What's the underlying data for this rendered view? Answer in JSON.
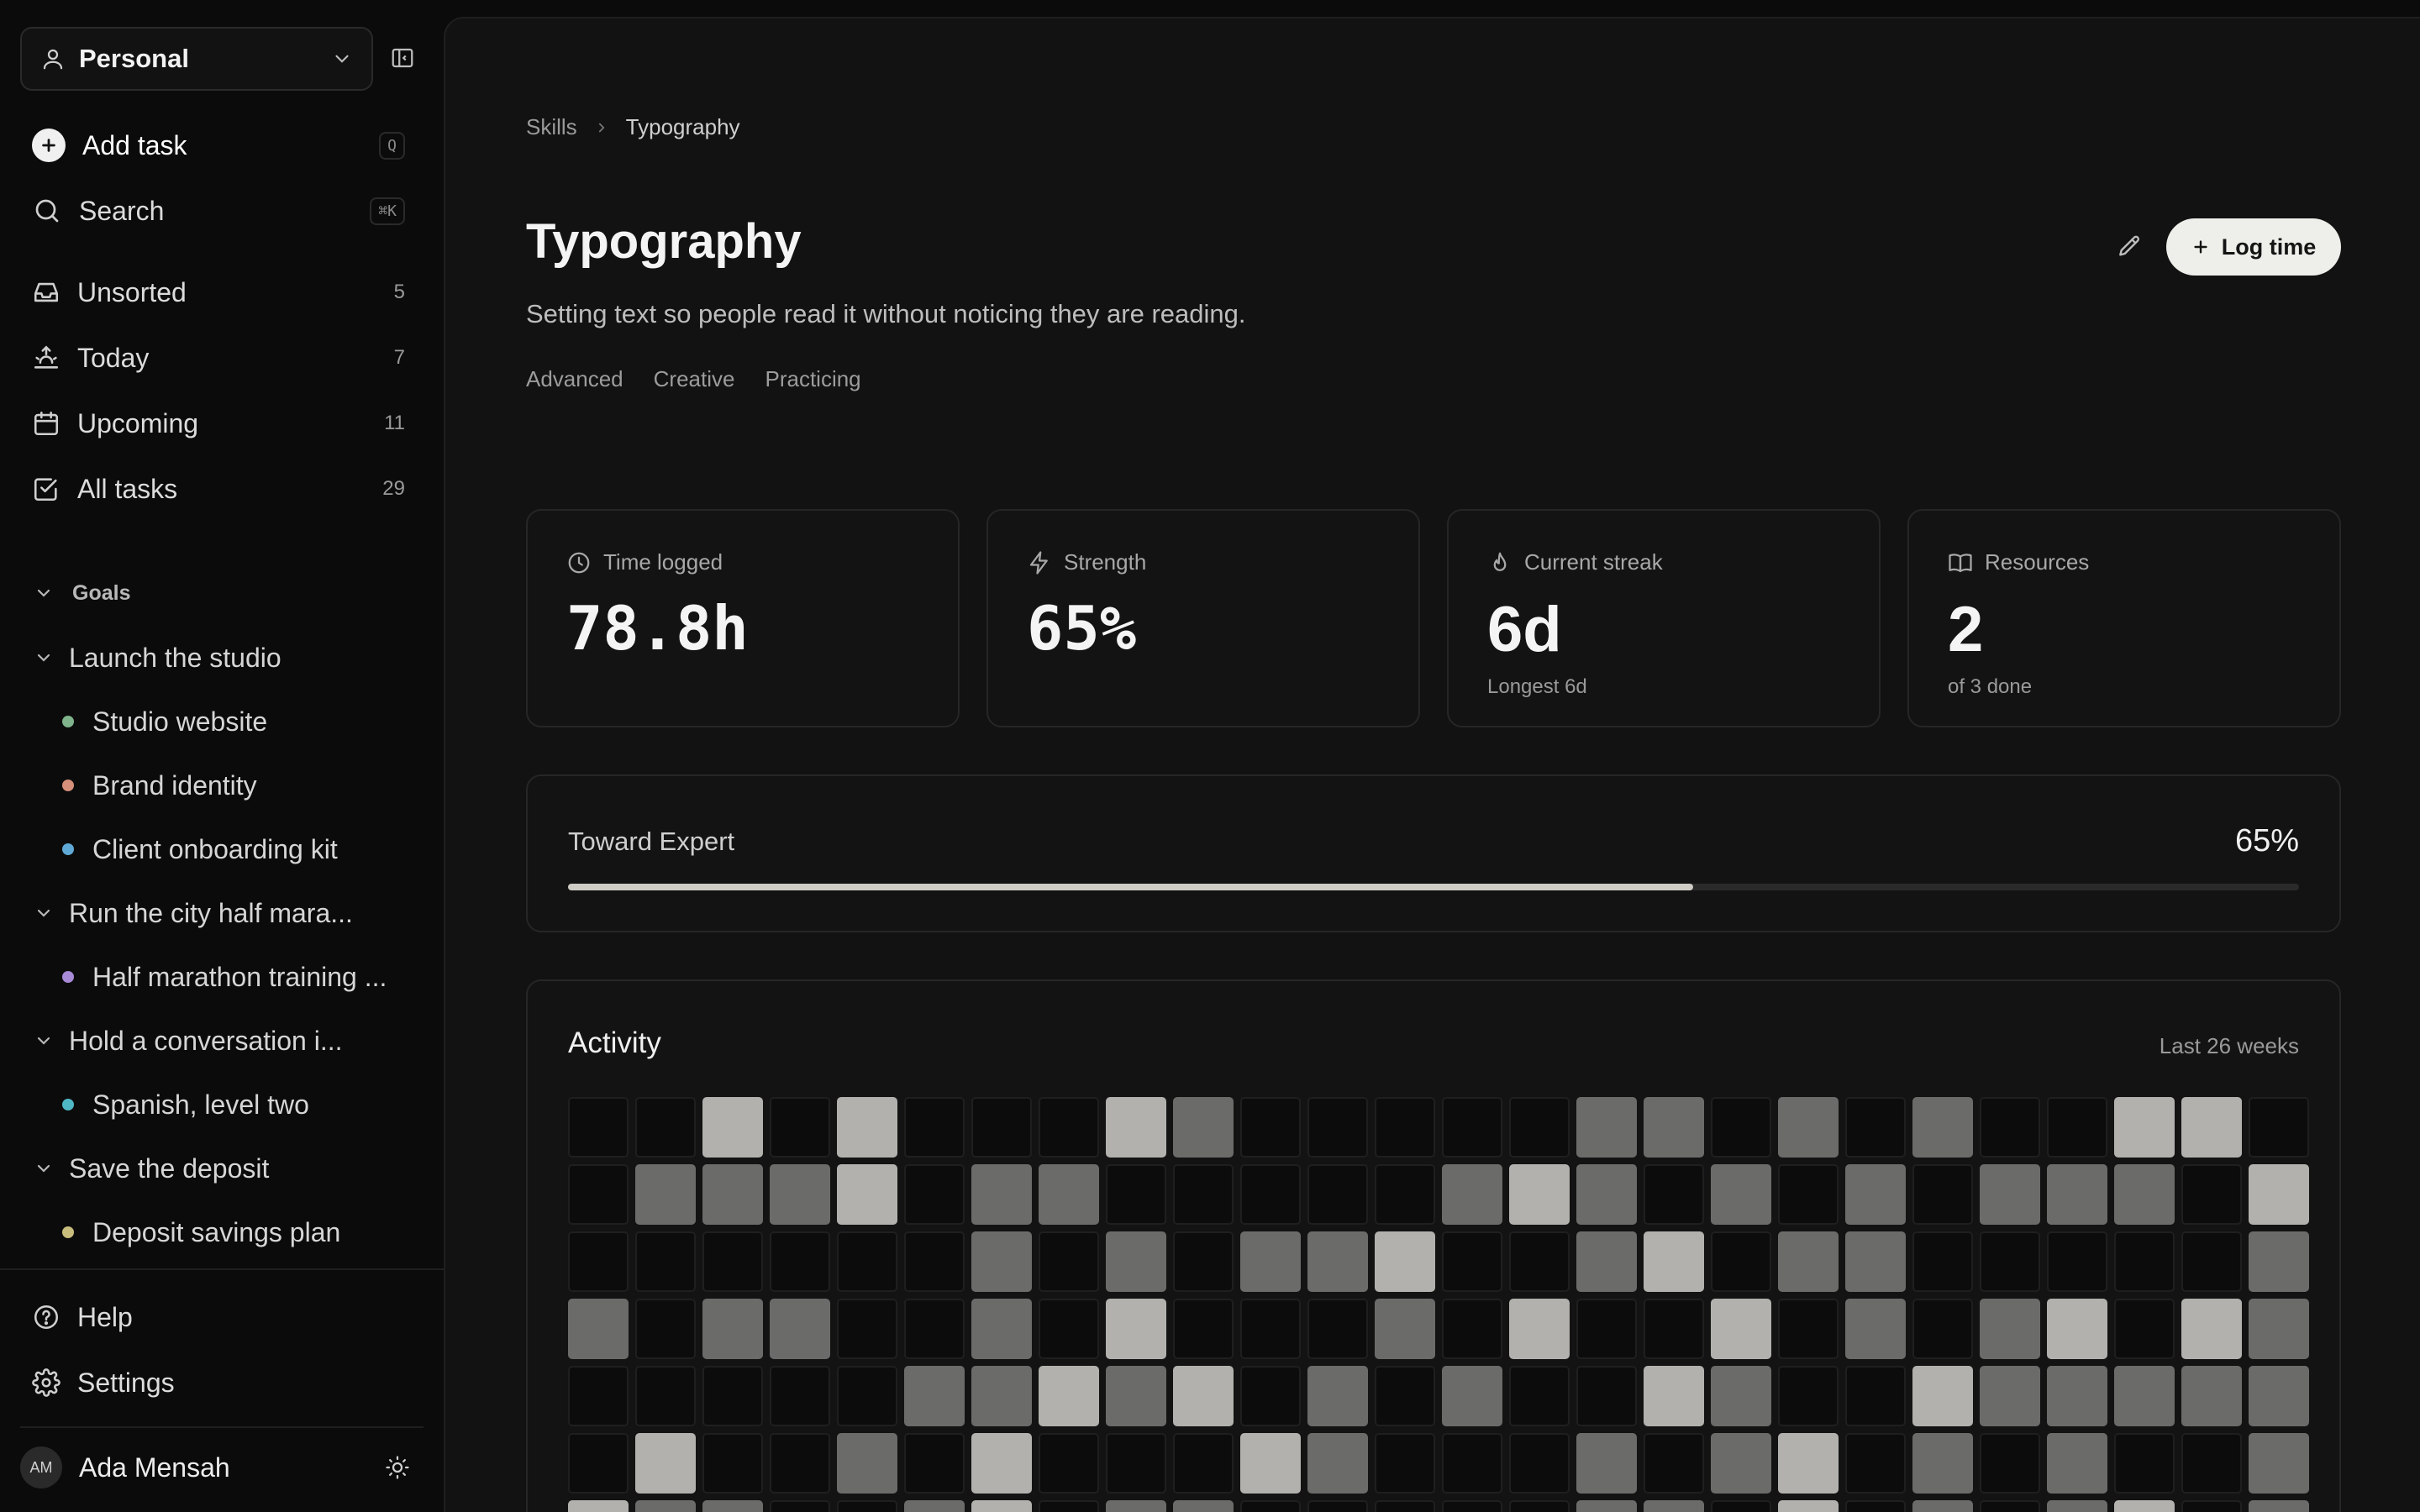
{
  "sidebar": {
    "workspace": "Personal",
    "add_task": {
      "label": "Add task",
      "shortcut": "Q"
    },
    "search": {
      "label": "Search",
      "shortcut": "⌘K"
    },
    "nav": [
      {
        "label": "Unsorted",
        "count": "5",
        "icon": "inbox-icon"
      },
      {
        "label": "Today",
        "count": "7",
        "icon": "sunrise-icon"
      },
      {
        "label": "Upcoming",
        "count": "11",
        "icon": "calendar-icon"
      },
      {
        "label": "All tasks",
        "count": "29",
        "icon": "check-square-icon"
      }
    ],
    "goals_header": "Goals",
    "goals": [
      {
        "label": "Launch the studio",
        "projects": [
          {
            "label": "Studio website",
            "color": "#7fb38b"
          },
          {
            "label": "Brand identity",
            "color": "#d68f7a"
          },
          {
            "label": "Client onboarding kit",
            "color": "#5fa9d6"
          }
        ]
      },
      {
        "label": "Run the city half mara...",
        "projects": [
          {
            "label": "Half marathon training ...",
            "color": "#a98ad6"
          }
        ]
      },
      {
        "label": "Hold a conversation i...",
        "projects": [
          {
            "label": "Spanish, level two",
            "color": "#4fb6c4"
          }
        ]
      },
      {
        "label": "Save the deposit",
        "projects": [
          {
            "label": "Deposit savings plan",
            "color": "#c9bd7e"
          }
        ]
      }
    ],
    "help": "Help",
    "settings": "Settings",
    "user": {
      "initials": "AM",
      "name": "Ada Mensah"
    }
  },
  "main": {
    "breadcrumb": [
      "Skills",
      "Typography"
    ],
    "title": "Typography",
    "description": "Setting text so people read it without noticing they are reading.",
    "tags": [
      "Advanced",
      "Creative",
      "Practicing"
    ],
    "log_time": "Log time",
    "stats": [
      {
        "label": "Time logged",
        "value": "78.8h",
        "sub": "",
        "icon": "clock-icon"
      },
      {
        "label": "Strength",
        "value": "65%",
        "sub": "",
        "icon": "bolt-icon"
      },
      {
        "label": "Current streak",
        "value": "6d",
        "sub": "Longest 6d",
        "icon": "flame-icon"
      },
      {
        "label": "Resources",
        "value": "2",
        "sub": "of 3 done",
        "icon": "book-icon"
      }
    ],
    "progress": {
      "label": "Toward Expert",
      "value_text": "65%",
      "fraction": 0.65
    },
    "activity": {
      "title": "Activity",
      "range": "Last 26 weeks",
      "levels": [
        [
          0,
          0,
          2,
          0,
          2,
          0,
          0,
          0,
          2,
          1,
          0,
          0,
          0,
          0,
          0,
          1,
          1,
          0,
          1,
          0,
          1,
          0,
          0,
          2,
          2,
          0
        ],
        [
          0,
          1,
          1,
          1,
          2,
          0,
          1,
          1,
          0,
          0,
          0,
          0,
          0,
          1,
          2,
          1,
          0,
          1,
          0,
          1,
          0,
          1,
          1,
          1,
          0,
          2
        ],
        [
          0,
          0,
          0,
          0,
          0,
          0,
          1,
          0,
          1,
          0,
          1,
          1,
          2,
          0,
          0,
          1,
          2,
          0,
          1,
          1,
          0,
          0,
          0,
          0,
          0,
          1
        ],
        [
          1,
          0,
          1,
          1,
          0,
          0,
          1,
          0,
          2,
          0,
          0,
          0,
          1,
          0,
          2,
          0,
          0,
          2,
          0,
          1,
          0,
          1,
          2,
          0,
          2,
          1
        ],
        [
          0,
          0,
          0,
          0,
          0,
          1,
          1,
          2,
          1,
          2,
          0,
          1,
          0,
          1,
          0,
          0,
          2,
          1,
          0,
          0,
          2,
          1,
          1,
          1,
          1,
          1
        ],
        [
          0,
          2,
          0,
          0,
          1,
          0,
          2,
          0,
          0,
          0,
          2,
          1,
          0,
          0,
          0,
          1,
          0,
          1,
          2,
          0,
          1,
          0,
          1,
          0,
          0,
          1
        ],
        [
          2,
          1,
          1,
          0,
          0,
          1,
          2,
          0,
          1,
          1,
          0,
          0,
          0,
          0,
          0,
          1,
          1,
          0,
          2,
          0,
          1,
          0,
          1,
          2,
          0,
          1
        ]
      ]
    }
  }
}
